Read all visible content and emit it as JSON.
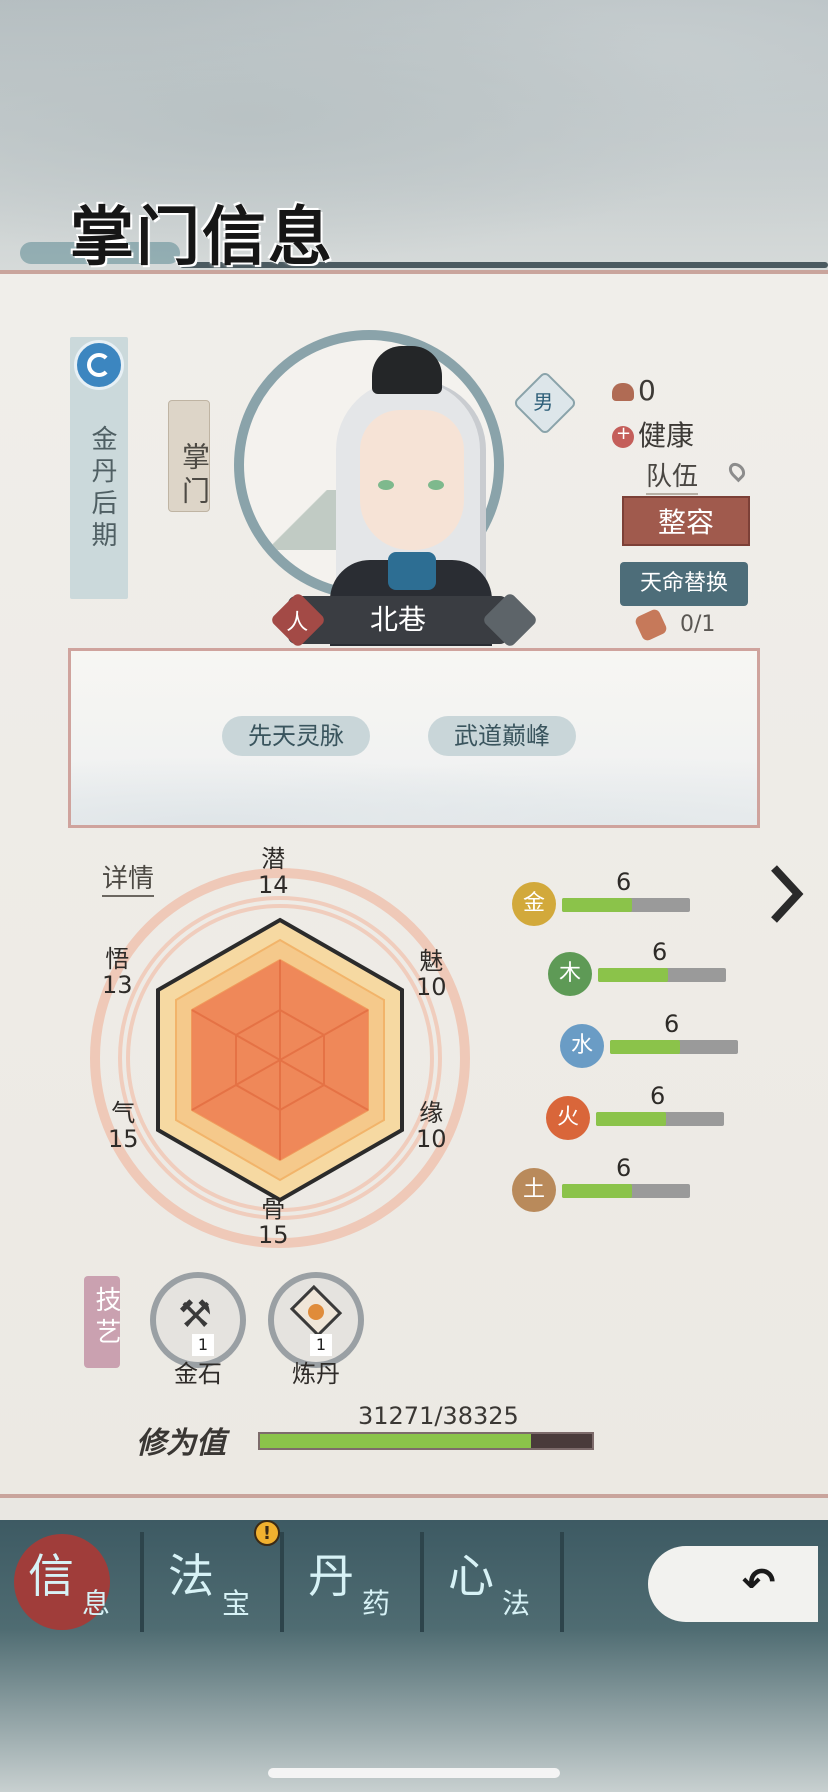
{
  "header": {
    "title": "掌门信息"
  },
  "character": {
    "realm": "金丹后期",
    "role": "掌门",
    "gender": "男",
    "race": "人",
    "name": "北巷"
  },
  "status": {
    "reputation": "0",
    "health": "健康",
    "team_label": "队伍",
    "makeover_button": "整容",
    "fate_button": "天命替换",
    "scroll_count": "0/1"
  },
  "traits": [
    "先天灵脉",
    "武道巅峰"
  ],
  "attributes": {
    "details_link": "详情",
    "stats": [
      {
        "name": "潜",
        "value": "14"
      },
      {
        "name": "魅",
        "value": "10"
      },
      {
        "name": "缘",
        "value": "10"
      },
      {
        "name": "骨",
        "value": "15"
      },
      {
        "name": "气",
        "value": "15"
      },
      {
        "name": "悟",
        "value": "13"
      }
    ]
  },
  "elements": [
    {
      "glyph": "金",
      "value": "6",
      "color": "#d2a93b",
      "fill_fraction": 0.55
    },
    {
      "glyph": "木",
      "value": "6",
      "color": "#5e9a56",
      "fill_fraction": 0.55
    },
    {
      "glyph": "水",
      "value": "6",
      "color": "#6a9cc5",
      "fill_fraction": 0.55
    },
    {
      "glyph": "火",
      "value": "6",
      "color": "#d9663a",
      "fill_fraction": 0.55
    },
    {
      "glyph": "土",
      "value": "6",
      "color": "#b98a5b",
      "fill_fraction": 0.55
    }
  ],
  "skills": {
    "label": "技艺",
    "items": [
      {
        "name": "金石",
        "level": "1",
        "icon": "pickaxe-icon"
      },
      {
        "name": "炼丹",
        "level": "1",
        "icon": "pill-furnace-icon"
      }
    ]
  },
  "cultivation": {
    "label": "修为值",
    "value": "31271/38325",
    "fraction": 0.816
  },
  "tabs": [
    {
      "big": "信",
      "small": "息",
      "active": true
    },
    {
      "big": "法",
      "small": "宝",
      "active": false,
      "alert": "!"
    },
    {
      "big": "丹",
      "small": "药",
      "active": false
    },
    {
      "big": "心",
      "small": "法",
      "active": false
    }
  ],
  "colors": {
    "accent_red": "#a05a4d",
    "fate_blue": "#4d6d79",
    "progress_green": "#8bc34a"
  }
}
